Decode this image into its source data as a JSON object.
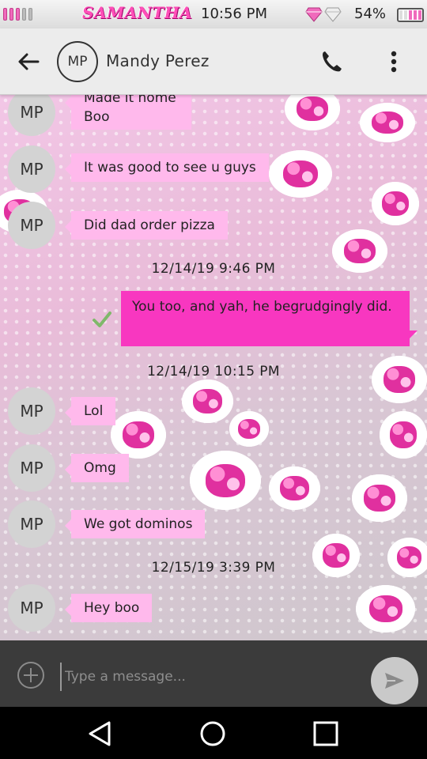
{
  "status_bar": {
    "carrier": "SAMANTHA",
    "time": "10:56 PM",
    "battery_percent": "54%",
    "signal_level": 0.6,
    "battery_level": 0.54,
    "accent_color": "#f06abc"
  },
  "header": {
    "avatar_initials": "MP",
    "contact_name": "Mandy Perez",
    "icons": [
      "arrow-back-icon",
      "phone-icon",
      "more-vert-icon"
    ]
  },
  "messages": [
    {
      "type": "incoming",
      "initials": "MP",
      "lines": [
        "Made it home",
        "Boo"
      ]
    },
    {
      "type": "incoming",
      "initials": "MP",
      "text": "It was good to see u guys"
    },
    {
      "type": "incoming",
      "initials": "MP",
      "text": "Did dad order pizza"
    },
    {
      "type": "timestamp",
      "text": "12/14/19 9:46 PM"
    },
    {
      "type": "outgoing",
      "text": "You too, and yah, he begrudgingly did.",
      "status_icon": "check-icon"
    },
    {
      "type": "timestamp",
      "text": "12/14/19 10:15 PM"
    },
    {
      "type": "incoming",
      "initials": "MP",
      "text": "Lol"
    },
    {
      "type": "incoming",
      "initials": "MP",
      "text": "Omg"
    },
    {
      "type": "incoming",
      "initials": "MP",
      "text": "We got dominos"
    },
    {
      "type": "timestamp",
      "text": "12/15/19 3:39 PM"
    },
    {
      "type": "incoming",
      "initials": "MP",
      "text": "Hey boo"
    }
  ],
  "compose": {
    "placeholder": "Type a message...",
    "value": "",
    "icons": [
      "add-circle-icon",
      "send-icon"
    ]
  },
  "colors": {
    "incoming_bubble": "#ffb9ec",
    "outgoing_bubble": "#f837c0",
    "compose_bar": "#3b3b3b"
  },
  "nav": {
    "icons": [
      "nav-back-icon",
      "nav-home-icon",
      "nav-recents-icon"
    ]
  }
}
